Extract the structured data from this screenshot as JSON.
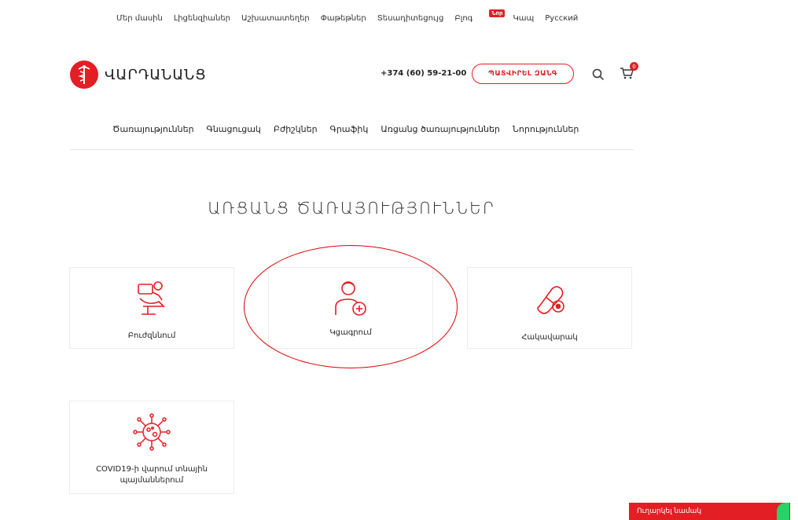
{
  "topnav": {
    "items": [
      "Մեր մասին",
      "Լիցենզիաներ",
      "Աշխատատեղեր",
      "Փաթեթներ",
      "Տեսադիտեցույց",
      "Բլոգ",
      "Կապ",
      "Русский"
    ],
    "blog_badge": "Նոր"
  },
  "header": {
    "logo_text": "ՎԱՐԴԱՆԱՆՑ",
    "phone": "+374 (60) 59-21-00",
    "order_button": "ՊԱՏՎԻՐԵԼ ԶԱՆԳ",
    "cart_count": "0"
  },
  "mainnav": {
    "items": [
      "Ծառայություններ",
      "Գնացուցակ",
      "Բժիշկներ",
      "Գրաֆիկ",
      "Առցանց ծառայություններ",
      "Նորություններ"
    ]
  },
  "page": {
    "title": "ԱՌՑԱՆՑ ԾԱՌԱՅՈՒԹՅՈՒՆՆԵՐ"
  },
  "cards": [
    {
      "label": "Բուժզննում",
      "icon": "dental-chair-icon"
    },
    {
      "label": "Կցագրում",
      "icon": "doctor-plus-icon"
    },
    {
      "label": "Հակավարակ",
      "icon": "pill-capsule-icon"
    },
    {
      "label": "COVID19-ի վարում տնային պայմաններում",
      "icon": "virus-icon"
    }
  ],
  "feedback": {
    "label": "Ուղարկել նամակ"
  },
  "colors": {
    "accent": "#e31e24",
    "whatsapp": "#25d366"
  }
}
